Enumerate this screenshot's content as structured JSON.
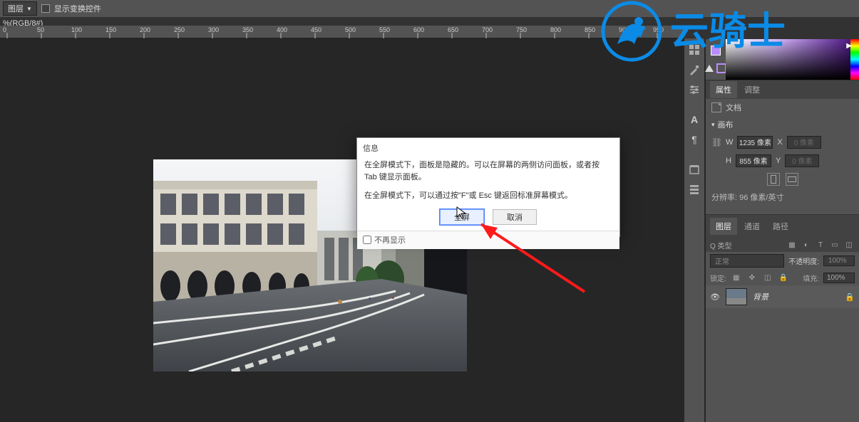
{
  "toolbar": {
    "dropdown_label": "图层",
    "checkbox_label": "显示变换控件"
  },
  "document": {
    "tab_text": "%(RGB/8#)"
  },
  "ruler": {
    "ticks": [
      "0",
      "50",
      "100",
      "150",
      "200",
      "250",
      "300",
      "350",
      "400",
      "450",
      "500",
      "550",
      "600",
      "650",
      "700",
      "750",
      "800",
      "850",
      "900",
      "950"
    ]
  },
  "dialog": {
    "title": "信息",
    "line1": "在全屏模式下，面板是隐藏的。可以在屏幕的两侧访问面板，或者按 Tab 键显示面板。",
    "line2": "在全屏模式下，可以通过按\"F\"或 Esc 键返回标准屏幕模式。",
    "ok": "全屏",
    "cancel": "取消",
    "dont_show": "不再显示"
  },
  "panels": {
    "properties_tab": "属性",
    "adjust_tab": "调整",
    "doc_label": "文档",
    "canvas_label": "画布",
    "w_label": "W",
    "w_value": "1235 像素",
    "x_label": "X",
    "x_value": "0 像素",
    "h_label": "H",
    "h_value": "855 像素",
    "y_label": "Y",
    "y_value": "0 像素",
    "resolution_text": "分辨率: 96 像素/英寸"
  },
  "layers": {
    "tab_layers": "图层",
    "tab_channels": "通道",
    "tab_paths": "路径",
    "type_label": "Q 类型",
    "blend_mode": "正常",
    "opacity_label": "不透明度:",
    "opacity_value": "100%",
    "lock_label": "锁定:",
    "fill_label": "填充:",
    "fill_value": "100%",
    "bg_layer_name": "背景"
  },
  "logo_text": "云骑士"
}
